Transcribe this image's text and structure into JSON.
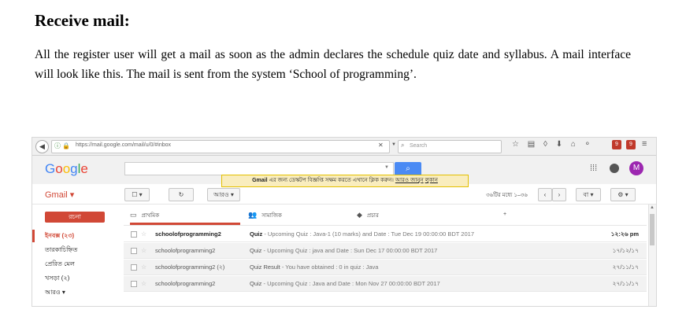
{
  "doc": {
    "heading": "Receive mail:",
    "paragraph": "All the register user will get a mail as soon as the admin declares the schedule quiz date and syllabus. A mail interface will look like this. The mail is sent from the system ‘School of programming’."
  },
  "browser": {
    "url": "https://mail.google.com/mail/u/0/#inbox",
    "search_placeholder": "Search",
    "close_glyph": "✕",
    "ext_badge_1": "9",
    "ext_badge_2": "9",
    "toolbar_icons": [
      "star-icon",
      "clipboard-icon",
      "pocket-icon",
      "download-icon",
      "home-icon",
      "profile-icon"
    ]
  },
  "gmail": {
    "logo": "Google",
    "notice_bold": "Gmail",
    "notice_text": "এর জন্য ডেস্কটপ বিজ্ঞপ্তি সক্ষম করতে এখানে ক্লিক করুন।",
    "notice_link1": "আরও জানুন",
    "notice_link2": "লুকান",
    "avatar_letter": "M",
    "gmail_label": "Gmail ▾",
    "more_label": "আরও ▾",
    "page_count": "৩৬টির মধ্যে ১–৩৬",
    "lang_label": "বা ▾",
    "compose": "রচনা",
    "sidebar": [
      {
        "label": "ইনবক্স (২৩)",
        "active": true
      },
      {
        "label": "তারকাচিহ্নিত",
        "active": false
      },
      {
        "label": "প্রেরিত মেল",
        "active": false
      },
      {
        "label": "খসড়া (২)",
        "active": false
      },
      {
        "label": "আরও ▾",
        "active": false
      }
    ],
    "tabs": [
      {
        "icon": "inbox-icon",
        "label": "প্রাথমিক"
      },
      {
        "icon": "people-icon",
        "label": "সামাজিক"
      },
      {
        "icon": "tag-icon",
        "label": "প্রচার"
      }
    ],
    "add_tab": "+",
    "rows": [
      {
        "sender": "schoolofprogramming2",
        "title": "Quiz",
        "snippet": " - Upcoming Quiz : Java-1 (10 marks) and Date : Tue Dec 19 00:00:00 BDT 2017",
        "date": "১২:২৬ pm",
        "unread": true
      },
      {
        "sender": "schoolofprogramming2",
        "title": "Quiz",
        "snippet": " - Upcoming Quiz : java and Date : Sun Dec 17 00:00:00 BDT 2017",
        "date": "১৭/১২/১৭",
        "unread": false
      },
      {
        "sender": "schoolofprogramming2 (২)",
        "title": "Quiz Result",
        "snippet": " - You have obtained : 0 in quiz : Java",
        "date": "২৭/১১/১৭",
        "unread": false
      },
      {
        "sender": "schoolofprogramming2",
        "title": "Quiz",
        "snippet": " - Upcoming Quiz : Java and Date : Mon Nov 27 00:00:00 BDT 2017",
        "date": "২৭/১১/১৭",
        "unread": false
      }
    ]
  }
}
